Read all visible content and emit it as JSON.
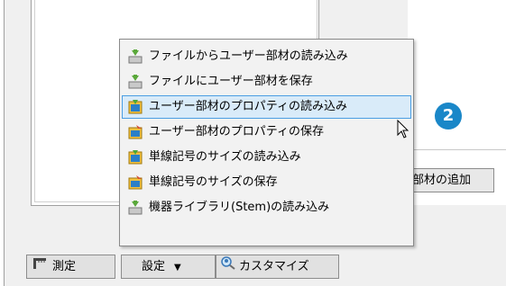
{
  "menu": {
    "items": [
      {
        "label": "ファイルからユーザー部材の読み込み",
        "icon": "import-user-member-icon",
        "highlighted": false
      },
      {
        "label": "ファイルにユーザー部材を保存",
        "icon": "save-user-member-icon",
        "highlighted": false
      },
      {
        "label": "ユーザー部材のプロパティの読み込み",
        "icon": "load-property-icon",
        "highlighted": true
      },
      {
        "label": "ユーザー部材のプロパティの保存",
        "icon": "save-property-icon",
        "highlighted": false
      },
      {
        "label": "単線記号のサイズの読み込み",
        "icon": "load-size-icon",
        "highlighted": false
      },
      {
        "label": "単線記号のサイズの保存",
        "icon": "save-size-icon",
        "highlighted": false
      },
      {
        "label": "機器ライブラリ(Stem)の読み込み",
        "icon": "stem-library-icon",
        "highlighted": false
      }
    ]
  },
  "side_button": {
    "label": "部材の追加"
  },
  "toolbar": {
    "measure_label": "測定",
    "settings_label": "設定",
    "customize_label": "カスタマイズ"
  },
  "badge": {
    "number": "2"
  },
  "colors": {
    "accent": "#1a87c8",
    "highlight_fill": "#d9ebf9",
    "highlight_border": "#4a9ee3",
    "menu_bg": "#f2f2f2"
  }
}
